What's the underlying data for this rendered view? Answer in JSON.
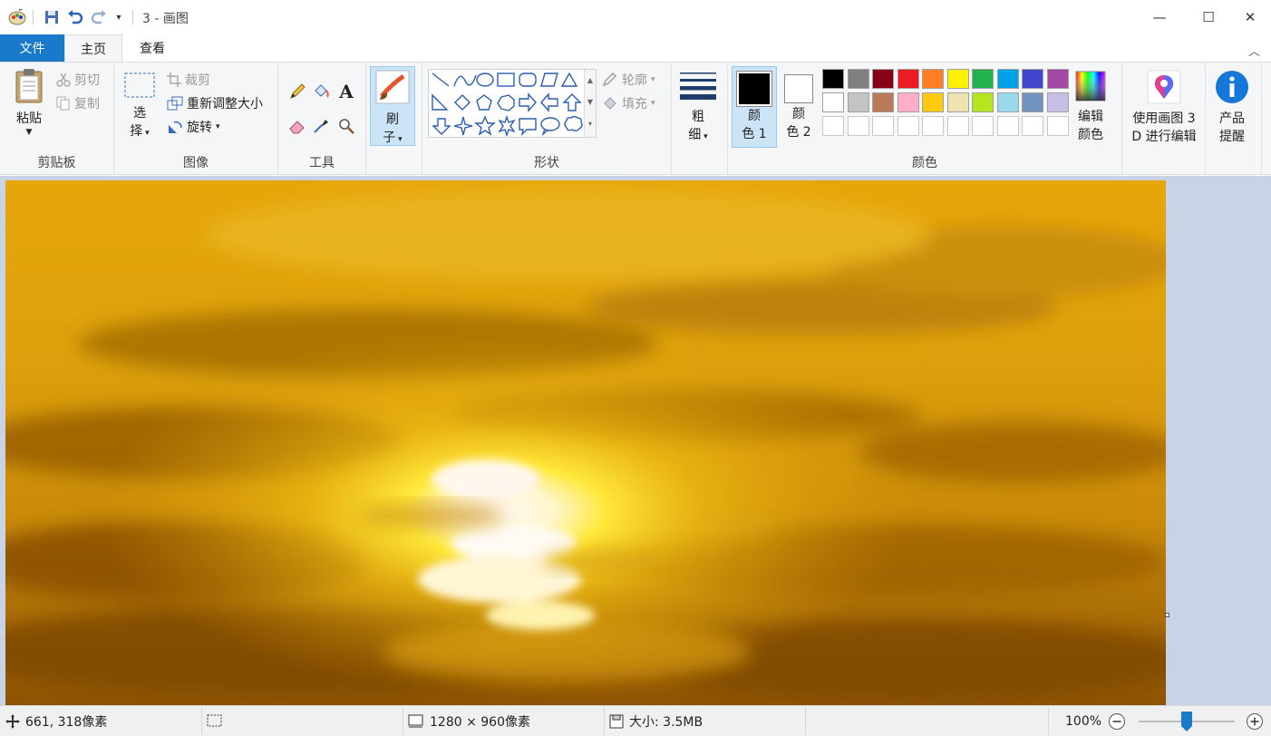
{
  "window": {
    "title": "3 - 画图",
    "minimize": "—",
    "maximize": "☐",
    "close": "✕"
  },
  "tabs": {
    "file": "文件",
    "home": "主页",
    "view": "查看"
  },
  "ribbon": {
    "clipboard": {
      "label": "剪贴板",
      "paste": "粘贴",
      "cut": "剪切",
      "copy": "复制"
    },
    "image": {
      "label": "图像",
      "select_line1": "选",
      "select_line2": "择",
      "crop": "裁剪",
      "resize": "重新调整大小",
      "rotate": "旋转"
    },
    "tools": {
      "label": "工具"
    },
    "brushes": {
      "line1": "刷",
      "line2": "子"
    },
    "shapes": {
      "label": "形状",
      "outline": "轮廓",
      "fill": "填充"
    },
    "size": {
      "line1": "粗",
      "line2": "细"
    },
    "colors": {
      "label": "颜色",
      "color1_line1": "颜",
      "color1_line2": "色 1",
      "color2_line1": "颜",
      "color2_line2": "色 2",
      "edit_line1": "编辑",
      "edit_line2": "颜色",
      "color1_value": "#000000",
      "color2_value": "#ffffff",
      "palette_row1": [
        "#000000",
        "#7f7f7f",
        "#880015",
        "#ed1c24",
        "#ff7f27",
        "#fff200",
        "#22b14c",
        "#00a2e8",
        "#3f48cc",
        "#a349a4"
      ],
      "palette_row2": [
        "#ffffff",
        "#c3c3c3",
        "#b97a57",
        "#ffaec9",
        "#ffc90e",
        "#efe4b0",
        "#b5e61d",
        "#99d9ea",
        "#7092be",
        "#c8bfe7"
      ]
    },
    "paint3d": {
      "line1": "使用画图 3",
      "line2": "D 进行编辑"
    },
    "product": {
      "line1": "产品",
      "line2": "提醒"
    }
  },
  "status": {
    "cursor": "661, 318像素",
    "dimensions": "1280 × 960像素",
    "size": "大小: 3.5MB",
    "zoom": "100%",
    "zoom_level": 1.0
  }
}
